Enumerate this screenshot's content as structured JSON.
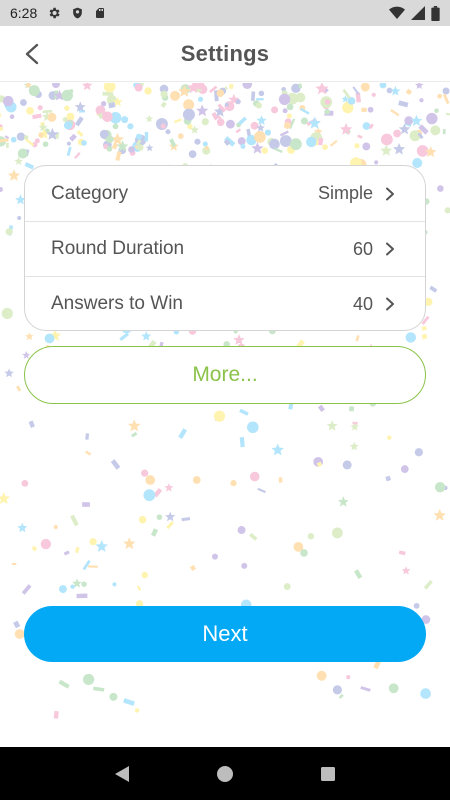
{
  "status_bar": {
    "time": "6:28",
    "icons": [
      "gear-icon",
      "shield-icon",
      "sd-card-icon",
      "wifi-icon",
      "cellular-icon",
      "battery-icon"
    ]
  },
  "app_bar": {
    "title": "Settings",
    "back_icon": "chevron-left-icon"
  },
  "settings": {
    "rows": [
      {
        "label": "Category",
        "value": "Simple"
      },
      {
        "label": "Round Duration",
        "value": "60"
      },
      {
        "label": "Answers to Win",
        "value": "40"
      }
    ]
  },
  "more_button": {
    "label": "More..."
  },
  "next_button": {
    "label": "Next"
  },
  "nav_bar": {
    "icons": [
      "back-triangle-icon",
      "home-circle-icon",
      "recents-square-icon"
    ]
  },
  "colors": {
    "accent_blue": "#03a9f4",
    "accent_green": "#8bc34a",
    "status_bar_bg": "#d9d9d9",
    "nav_bar_bg": "#000000"
  }
}
